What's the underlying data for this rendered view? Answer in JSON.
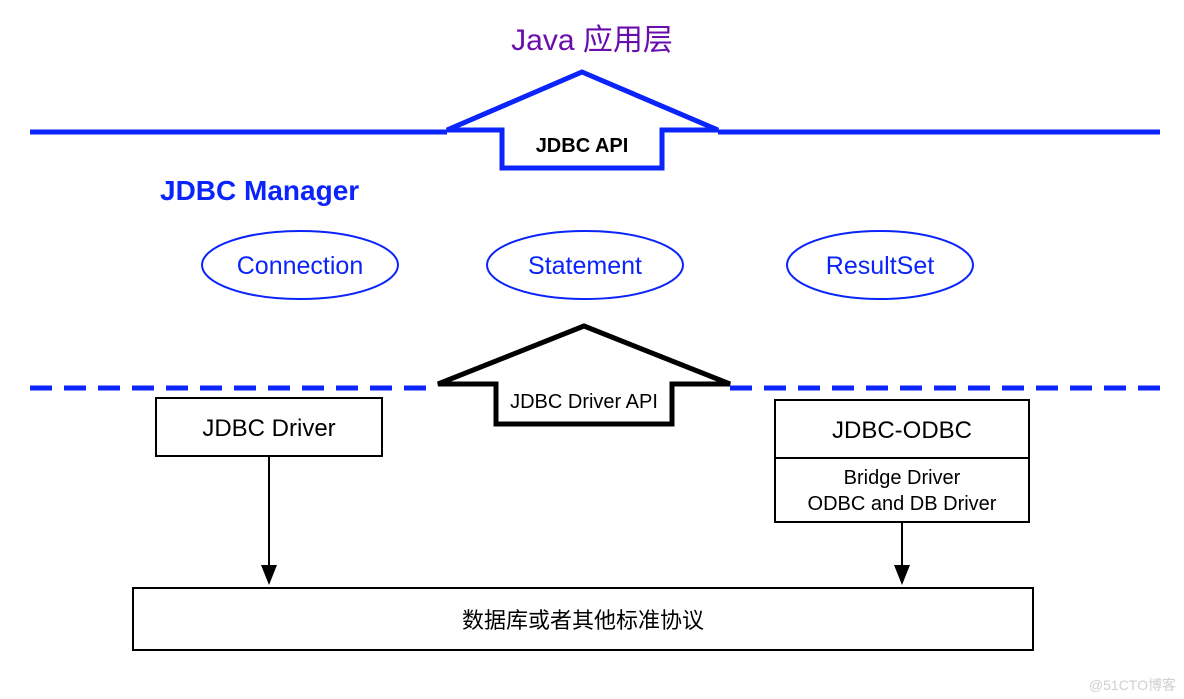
{
  "title": "Java 应用层",
  "jdbc_api_label": "JDBC API",
  "manager_label": "JDBC Manager",
  "ellipses": {
    "connection": "Connection",
    "statement": "Statement",
    "resultset": "ResultSet"
  },
  "driver_api_label": "JDBC Driver API",
  "jdbc_driver_box": "JDBC Driver",
  "jdbc_odbc_box": "JDBC-ODBC",
  "bridge_line1": "Bridge Driver",
  "bridge_line2": "ODBC and DB Driver",
  "db_box": "数据库或者其他标准协议",
  "watermark": "@51CTO博客",
  "colors": {
    "title": "#6a0dad",
    "blue": "#0b24fb",
    "black": "#000000"
  }
}
